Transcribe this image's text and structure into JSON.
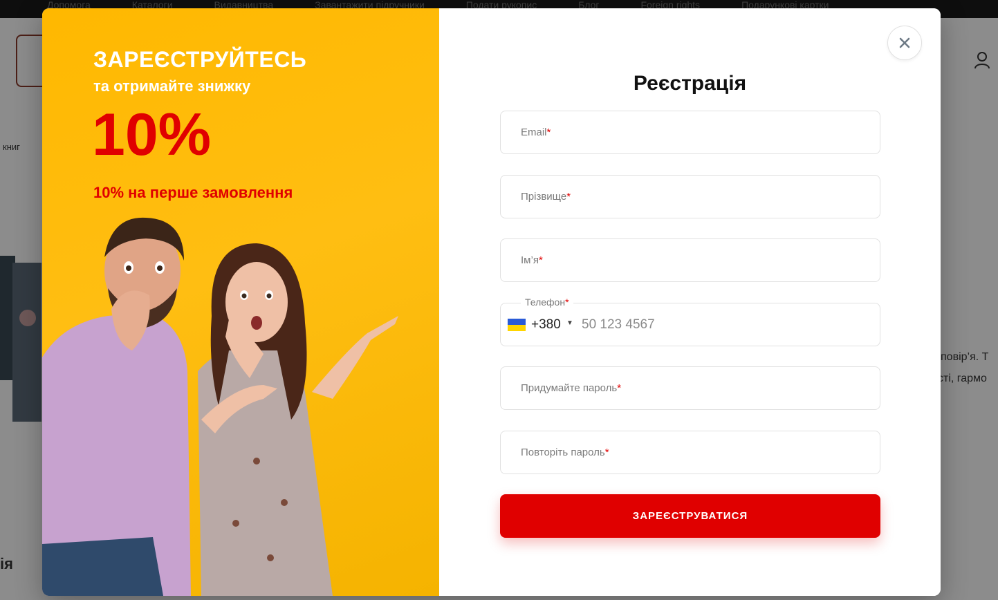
{
  "background": {
    "top_nav": [
      "Допомога",
      "Каталоги",
      "Видавництва",
      "Завантажити підручники",
      "Подати рукопис",
      "Блог",
      "Foreign rights",
      "Подарункові картки"
    ],
    "breadcrumb_fragment": "книг",
    "text_fragment_1": "повір’я.  Т",
    "text_fragment_2": "сті, гармо",
    "heading_fragment": "ія"
  },
  "promo": {
    "title": "ЗАРЕЄСТРУЙТЕСЬ",
    "subtitle": "та отримайте знижку",
    "discount": "10%",
    "detail": "10% на перше замовлення",
    "colors": {
      "background": "#FFB800",
      "accent": "#E00000"
    }
  },
  "form": {
    "title": "Реєстрація",
    "close_icon": "close-icon",
    "fields": {
      "email": {
        "label": "Email",
        "required_mark": "*",
        "value": ""
      },
      "lastname": {
        "label": "Прізвище",
        "required_mark": "*",
        "value": ""
      },
      "firstname": {
        "label": "Ім’я",
        "required_mark": "*",
        "value": ""
      },
      "phone": {
        "label": "Телефон",
        "required_mark": "*",
        "country_flag": "ukraine-flag-icon",
        "country_code": "+380",
        "placeholder": "50 123 4567",
        "value": ""
      },
      "password": {
        "label": "Придумайте пароль",
        "required_mark": "*",
        "value": ""
      },
      "password_repeat": {
        "label": "Повторіть пароль",
        "required_mark": "*",
        "value": ""
      }
    },
    "submit_label": "ЗАРЕЄСТРУВАТИСЯ",
    "colors": {
      "submit": "#E00000"
    }
  }
}
